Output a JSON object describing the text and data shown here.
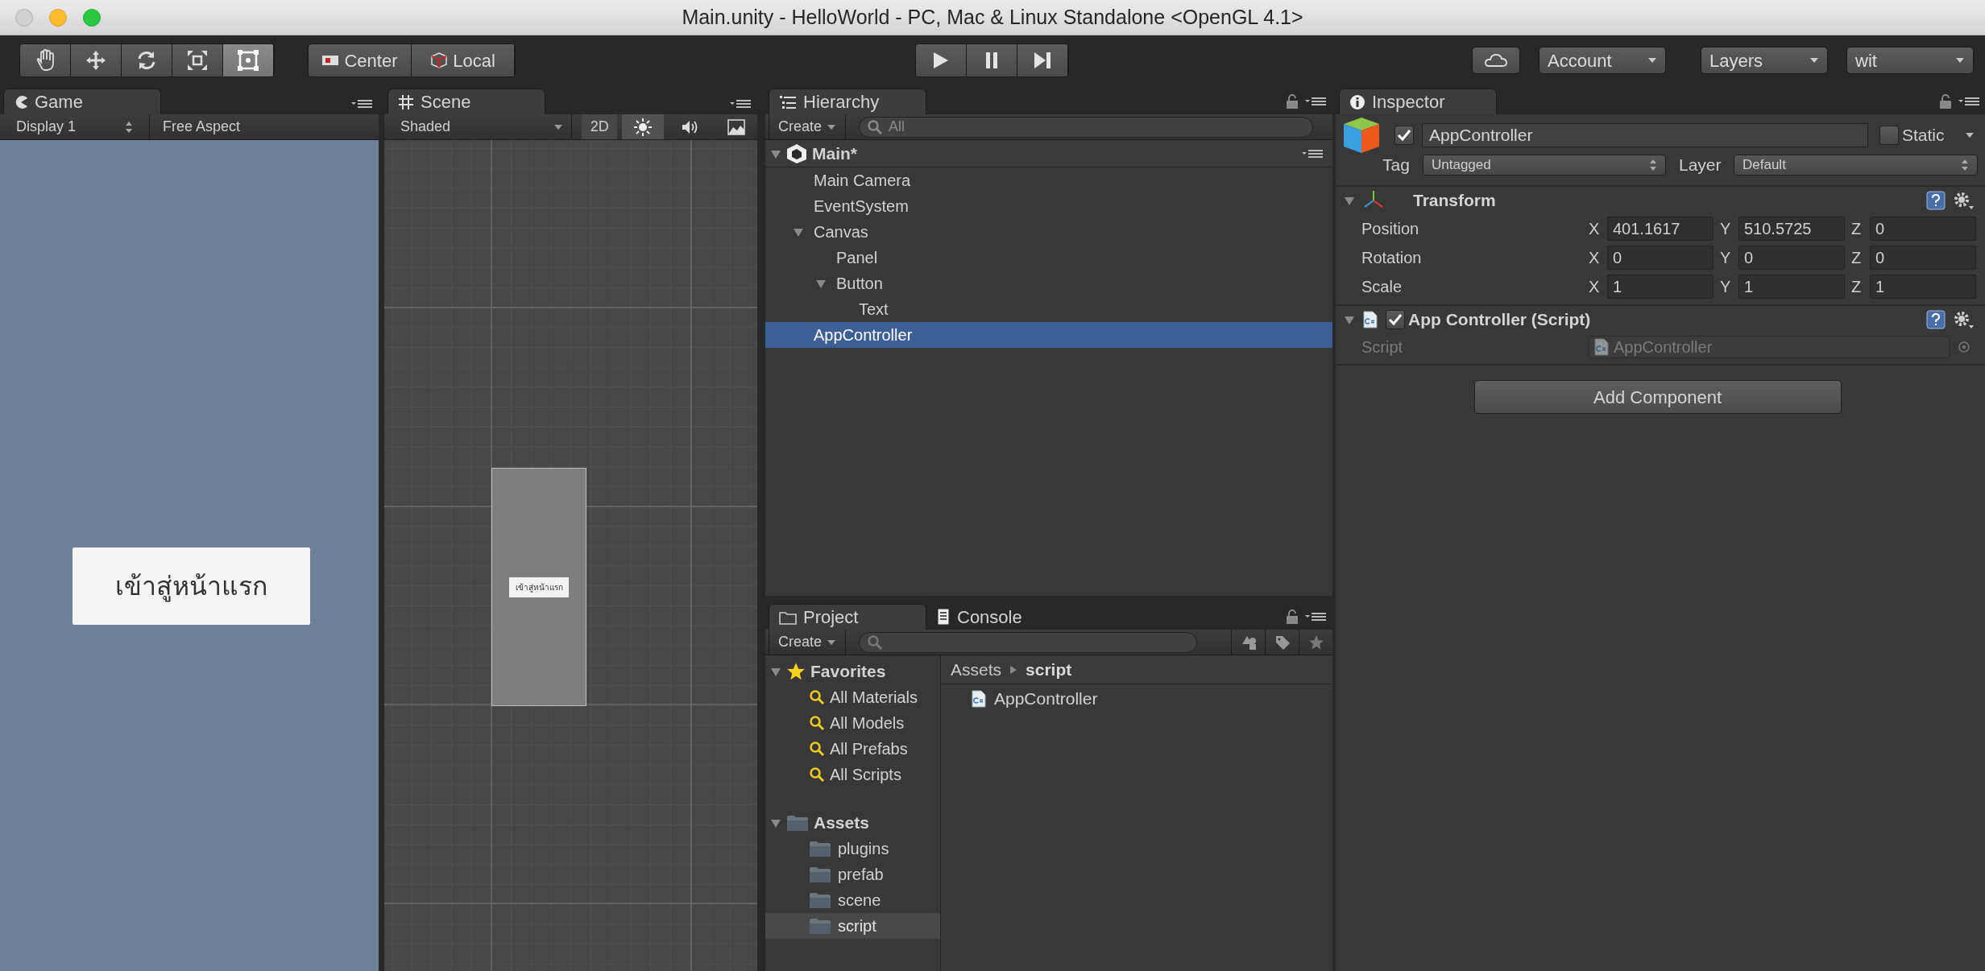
{
  "window": {
    "title": "Main.unity - HelloWorld - PC, Mac & Linux Standalone <OpenGL 4.1>"
  },
  "toolbar": {
    "tools": [
      {
        "kind": "hand",
        "selected": false
      },
      {
        "kind": "move",
        "selected": false
      },
      {
        "kind": "rotate",
        "selected": false
      },
      {
        "kind": "scale",
        "selected": false
      },
      {
        "kind": "rect",
        "selected": true
      }
    ],
    "pivot": [
      {
        "kind": "pivot",
        "label": "Center"
      },
      {
        "kind": "space",
        "label": "Local"
      }
    ],
    "playback": [
      {
        "kind": "play"
      },
      {
        "kind": "pause"
      },
      {
        "kind": "step"
      }
    ],
    "account": "Account",
    "layers": "Layers",
    "layout": "wit"
  },
  "game": {
    "tab": "Game",
    "display": "Display 1",
    "aspect": "Free Aspect",
    "button_text": "เข้าสู่หน้าแรก"
  },
  "scene": {
    "tab": "Scene",
    "shading": "Shaded",
    "mode": "2D",
    "toggles": [
      {
        "kind": "lighting",
        "on": true
      },
      {
        "kind": "audio",
        "on": false
      },
      {
        "kind": "effects",
        "on": false
      }
    ],
    "button_text": "เข้าสู่หน้าแรก"
  },
  "hierarchy": {
    "tab": "Hierarchy",
    "create": "Create",
    "search_placeholder": "All",
    "scene": "Main*",
    "items": [
      {
        "label": "Main Camera",
        "selected": false
      },
      {
        "label": "EventSystem",
        "selected": false
      },
      {
        "label": "Canvas",
        "selected": false,
        "expanded": true,
        "children": [
          {
            "label": "Panel",
            "selected": false
          },
          {
            "label": "Button",
            "selected": false,
            "expanded": true,
            "children": [
              {
                "label": "Text",
                "selected": false
              }
            ]
          }
        ]
      },
      {
        "label": "AppController",
        "selected": true
      }
    ]
  },
  "inspector": {
    "tab": "Inspector",
    "active": true,
    "name": "AppController",
    "static_label": "Static",
    "static": false,
    "tag_label": "Tag",
    "tag": "Untagged",
    "layer_label": "Layer",
    "layer": "Default",
    "components": [
      {
        "kind": "transform",
        "title": "Transform",
        "expanded": true,
        "rows": [
          {
            "label": "Position",
            "fields": [
              {
                "axis": "X",
                "value": "401.1617"
              },
              {
                "axis": "Y",
                "value": "510.5725"
              },
              {
                "axis": "Z",
                "value": "0"
              }
            ]
          },
          {
            "label": "Rotation",
            "fields": [
              {
                "axis": "X",
                "value": "0"
              },
              {
                "axis": "Y",
                "value": "0"
              },
              {
                "axis": "Z",
                "value": "0"
              }
            ]
          },
          {
            "label": "Scale",
            "fields": [
              {
                "axis": "X",
                "value": "1"
              },
              {
                "axis": "Y",
                "value": "1"
              },
              {
                "axis": "Z",
                "value": "1"
              }
            ]
          }
        ]
      },
      {
        "kind": "script",
        "title": "App Controller (Script)",
        "expanded": true,
        "enabled": true,
        "script_label": "Script",
        "script": "AppController"
      }
    ],
    "add_component": "Add Component"
  },
  "project": {
    "tabs": [
      {
        "label": "Project",
        "selected": true
      },
      {
        "label": "Console",
        "selected": false
      }
    ],
    "create": "Create",
    "favorites": {
      "label": "Favorites",
      "expanded": true,
      "items": [
        {
          "label": "All Materials"
        },
        {
          "label": "All Models"
        },
        {
          "label": "All Prefabs"
        },
        {
          "label": "All Scripts"
        }
      ]
    },
    "assets": {
      "label": "Assets",
      "expanded": true,
      "children": [
        {
          "label": "plugins",
          "selected": false
        },
        {
          "label": "prefab",
          "selected": false
        },
        {
          "label": "scene",
          "selected": false
        },
        {
          "label": "script",
          "selected": true
        }
      ]
    },
    "breadcrumb": [
      "Assets",
      "script"
    ],
    "files": [
      {
        "name": "AppController"
      }
    ]
  }
}
